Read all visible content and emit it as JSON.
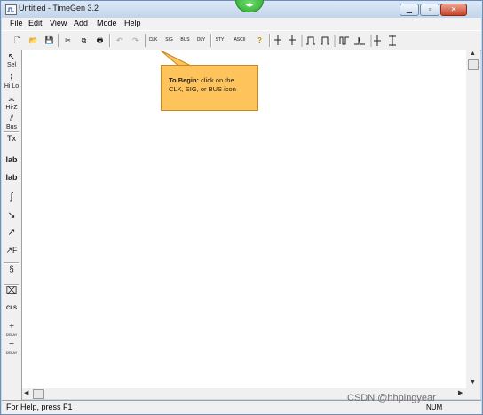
{
  "window": {
    "title": "Untitled - TimeGen 3.2"
  },
  "title_controls": {
    "minimize": "▁",
    "maximize": "▫",
    "close": "✕",
    "center_badge": "◂▸"
  },
  "menu": [
    "File",
    "Edit",
    "View",
    "Add",
    "Mode",
    "Help"
  ],
  "toolbar": {
    "new": "🗋",
    "open": "📂",
    "save": "💾",
    "cut": "✂",
    "copy": "⧉",
    "print": "🖶",
    "undo": "↶",
    "redo": "↷",
    "clk": "CLK",
    "sig": "SIG",
    "bus": "BUS",
    "dly": "DLY",
    "sty": "STY",
    "ascii": "ASCII",
    "help": "?"
  },
  "left_toolbar": {
    "select": "Sel",
    "wave": "Hi Lo",
    "hiz": "Hi-Z",
    "bus": "Bus",
    "text": "Tx",
    "label1": "lab",
    "label2": "lab",
    "edge1": "ʃ",
    "edge2": "↘",
    "arrow": "↗",
    "arrowf": "↗F",
    "break": "§",
    "eraser": "⌧",
    "clk2": "CLS",
    "delay1": "DELAY",
    "delay2": "DELAY"
  },
  "callout": {
    "title": "To Begin:",
    "line1": " click on the",
    "line2": "CLK, SIG, or BUS icon"
  },
  "status": {
    "help_text": "For Help, press F1",
    "num": "NUM"
  },
  "watermark": "CSDN @hhpingyear",
  "colors": {
    "callout_fill": "#ffc35c",
    "accent": "#6b8fb8"
  }
}
